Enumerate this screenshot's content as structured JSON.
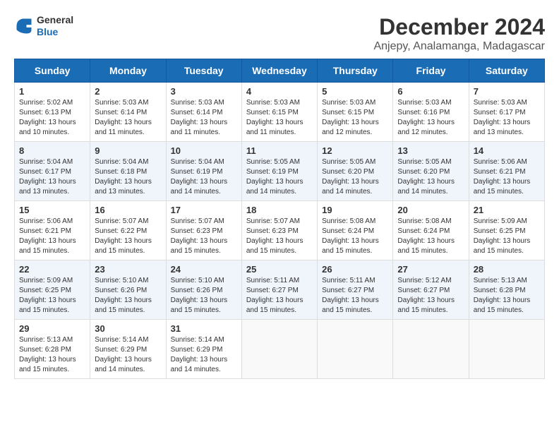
{
  "header": {
    "logo_general": "General",
    "logo_blue": "Blue",
    "main_title": "December 2024",
    "subtitle": "Anjepy, Analamanga, Madagascar"
  },
  "calendar": {
    "days_of_week": [
      "Sunday",
      "Monday",
      "Tuesday",
      "Wednesday",
      "Thursday",
      "Friday",
      "Saturday"
    ],
    "weeks": [
      [
        {
          "day": "",
          "info": ""
        },
        {
          "day": "2",
          "info": "Sunrise: 5:03 AM\nSunset: 6:14 PM\nDaylight: 13 hours and 11 minutes."
        },
        {
          "day": "3",
          "info": "Sunrise: 5:03 AM\nSunset: 6:14 PM\nDaylight: 13 hours and 11 minutes."
        },
        {
          "day": "4",
          "info": "Sunrise: 5:03 AM\nSunset: 6:15 PM\nDaylight: 13 hours and 11 minutes."
        },
        {
          "day": "5",
          "info": "Sunrise: 5:03 AM\nSunset: 6:15 PM\nDaylight: 13 hours and 12 minutes."
        },
        {
          "day": "6",
          "info": "Sunrise: 5:03 AM\nSunset: 6:16 PM\nDaylight: 13 hours and 12 minutes."
        },
        {
          "day": "7",
          "info": "Sunrise: 5:03 AM\nSunset: 6:17 PM\nDaylight: 13 hours and 13 minutes."
        }
      ],
      [
        {
          "day": "1",
          "info": "Sunrise: 5:02 AM\nSunset: 6:13 PM\nDaylight: 13 hours and 10 minutes."
        },
        null,
        null,
        null,
        null,
        null,
        null
      ],
      [
        {
          "day": "8",
          "info": "Sunrise: 5:04 AM\nSunset: 6:17 PM\nDaylight: 13 hours and 13 minutes."
        },
        {
          "day": "9",
          "info": "Sunrise: 5:04 AM\nSunset: 6:18 PM\nDaylight: 13 hours and 13 minutes."
        },
        {
          "day": "10",
          "info": "Sunrise: 5:04 AM\nSunset: 6:19 PM\nDaylight: 13 hours and 14 minutes."
        },
        {
          "day": "11",
          "info": "Sunrise: 5:05 AM\nSunset: 6:19 PM\nDaylight: 13 hours and 14 minutes."
        },
        {
          "day": "12",
          "info": "Sunrise: 5:05 AM\nSunset: 6:20 PM\nDaylight: 13 hours and 14 minutes."
        },
        {
          "day": "13",
          "info": "Sunrise: 5:05 AM\nSunset: 6:20 PM\nDaylight: 13 hours and 14 minutes."
        },
        {
          "day": "14",
          "info": "Sunrise: 5:06 AM\nSunset: 6:21 PM\nDaylight: 13 hours and 15 minutes."
        }
      ],
      [
        {
          "day": "15",
          "info": "Sunrise: 5:06 AM\nSunset: 6:21 PM\nDaylight: 13 hours and 15 minutes."
        },
        {
          "day": "16",
          "info": "Sunrise: 5:07 AM\nSunset: 6:22 PM\nDaylight: 13 hours and 15 minutes."
        },
        {
          "day": "17",
          "info": "Sunrise: 5:07 AM\nSunset: 6:23 PM\nDaylight: 13 hours and 15 minutes."
        },
        {
          "day": "18",
          "info": "Sunrise: 5:07 AM\nSunset: 6:23 PM\nDaylight: 13 hours and 15 minutes."
        },
        {
          "day": "19",
          "info": "Sunrise: 5:08 AM\nSunset: 6:24 PM\nDaylight: 13 hours and 15 minutes."
        },
        {
          "day": "20",
          "info": "Sunrise: 5:08 AM\nSunset: 6:24 PM\nDaylight: 13 hours and 15 minutes."
        },
        {
          "day": "21",
          "info": "Sunrise: 5:09 AM\nSunset: 6:25 PM\nDaylight: 13 hours and 15 minutes."
        }
      ],
      [
        {
          "day": "22",
          "info": "Sunrise: 5:09 AM\nSunset: 6:25 PM\nDaylight: 13 hours and 15 minutes."
        },
        {
          "day": "23",
          "info": "Sunrise: 5:10 AM\nSunset: 6:26 PM\nDaylight: 13 hours and 15 minutes."
        },
        {
          "day": "24",
          "info": "Sunrise: 5:10 AM\nSunset: 6:26 PM\nDaylight: 13 hours and 15 minutes."
        },
        {
          "day": "25",
          "info": "Sunrise: 5:11 AM\nSunset: 6:27 PM\nDaylight: 13 hours and 15 minutes."
        },
        {
          "day": "26",
          "info": "Sunrise: 5:11 AM\nSunset: 6:27 PM\nDaylight: 13 hours and 15 minutes."
        },
        {
          "day": "27",
          "info": "Sunrise: 5:12 AM\nSunset: 6:27 PM\nDaylight: 13 hours and 15 minutes."
        },
        {
          "day": "28",
          "info": "Sunrise: 5:13 AM\nSunset: 6:28 PM\nDaylight: 13 hours and 15 minutes."
        }
      ],
      [
        {
          "day": "29",
          "info": "Sunrise: 5:13 AM\nSunset: 6:28 PM\nDaylight: 13 hours and 15 minutes."
        },
        {
          "day": "30",
          "info": "Sunrise: 5:14 AM\nSunset: 6:29 PM\nDaylight: 13 hours and 14 minutes."
        },
        {
          "day": "31",
          "info": "Sunrise: 5:14 AM\nSunset: 6:29 PM\nDaylight: 13 hours and 14 minutes."
        },
        {
          "day": "",
          "info": ""
        },
        {
          "day": "",
          "info": ""
        },
        {
          "day": "",
          "info": ""
        },
        {
          "day": "",
          "info": ""
        }
      ]
    ]
  }
}
